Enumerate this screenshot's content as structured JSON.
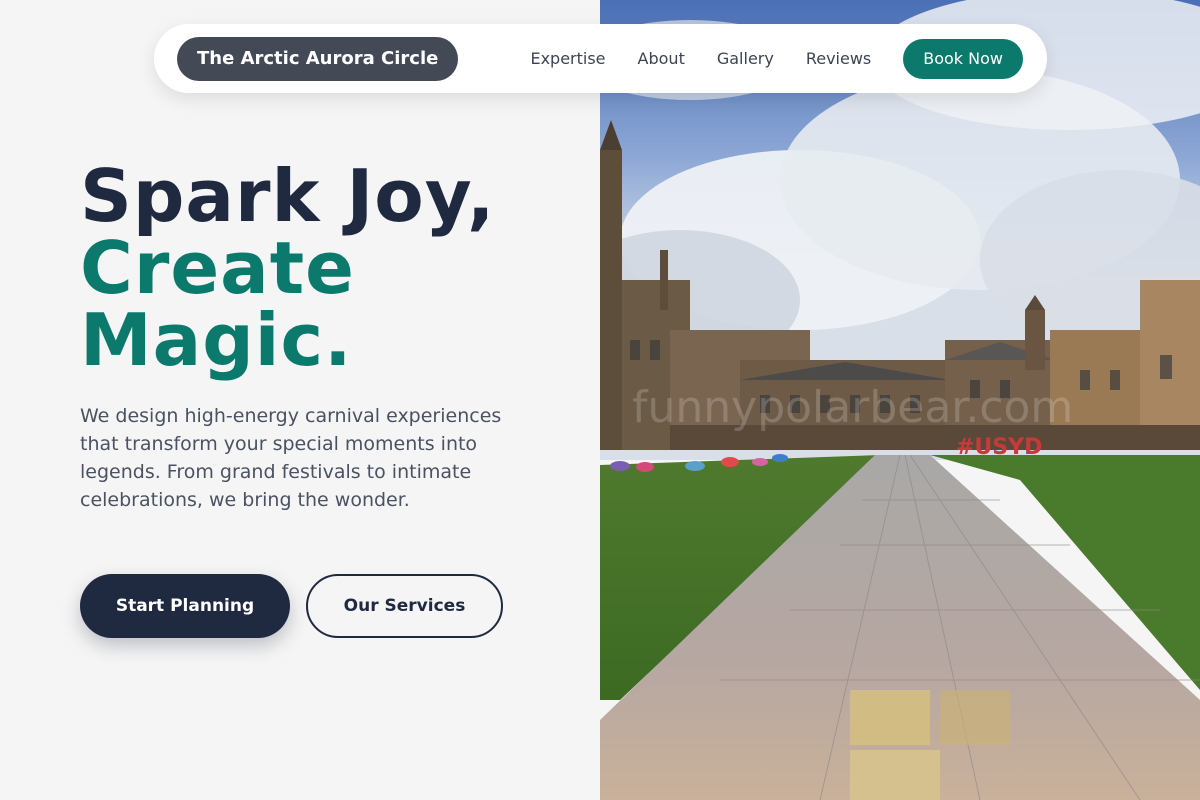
{
  "nav": {
    "brand": "The Arctic Aurora Circle",
    "links": [
      "Expertise",
      "About",
      "Gallery",
      "Reviews"
    ],
    "cta": "Book Now"
  },
  "hero": {
    "title_line1": "Spark Joy,",
    "title_line2": "Create",
    "title_line3": "Magic.",
    "description": "We design high-energy carnival experiences that transform your special moments into legends. From grand festivals to intimate celebrations, we bring the wonder.",
    "primary_button": "Start Planning",
    "secondary_button": "Our Services"
  },
  "photo": {
    "watermark": "funnypolarbear.com",
    "sign": "#USYD"
  },
  "colors": {
    "accent": "#0b7a6d",
    "dark": "#1f2940",
    "brand_pill": "#434a56"
  }
}
